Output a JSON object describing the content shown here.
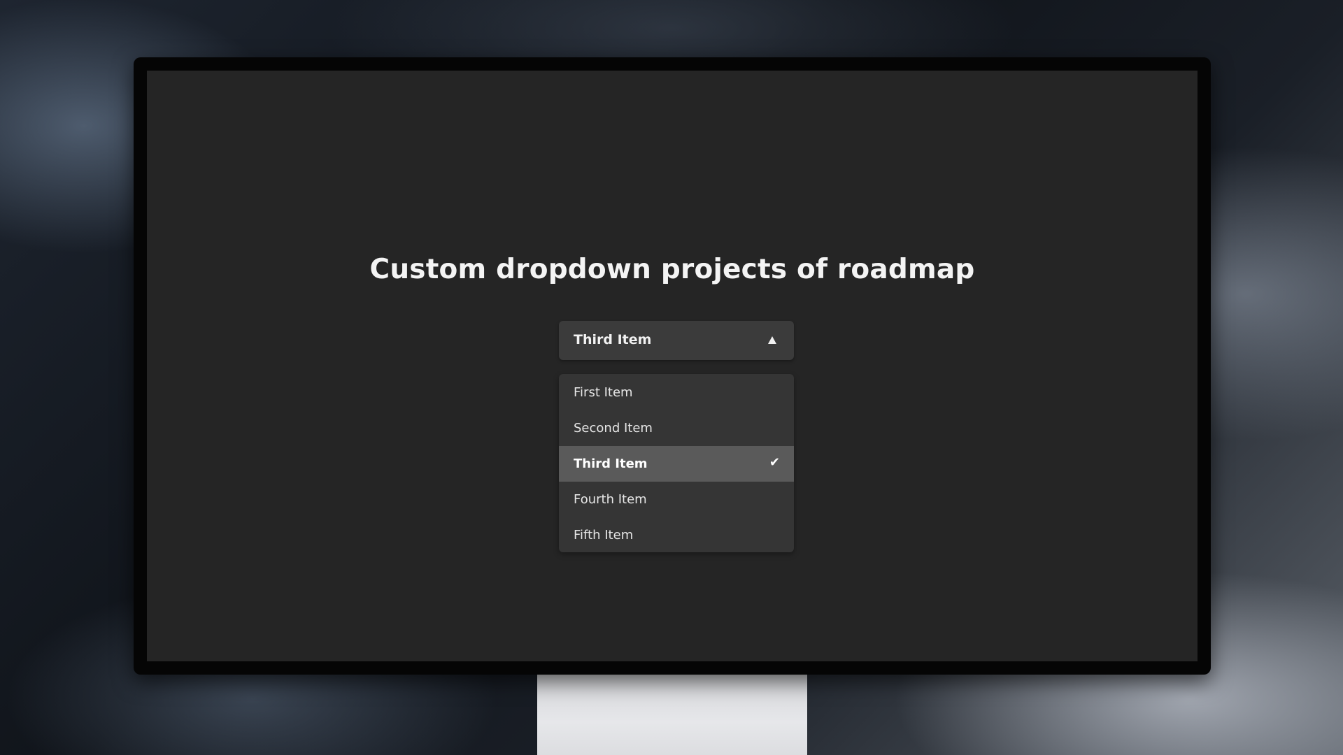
{
  "page": {
    "title": "Custom dropdown projects of roadmap"
  },
  "dropdown": {
    "selected_label": "Third Item",
    "toggle_icon": "caret-up-icon",
    "is_open": true,
    "options": [
      {
        "label": "First Item",
        "selected": false
      },
      {
        "label": "Second Item",
        "selected": false
      },
      {
        "label": "Third Item",
        "selected": true,
        "icon": "check-icon",
        "glyph": "✔"
      },
      {
        "label": "Fourth Item",
        "selected": false
      },
      {
        "label": "Fifth Item",
        "selected": false
      }
    ]
  },
  "colors": {
    "screen_background": "#252525",
    "select_background": "#3b3b3b",
    "list_background": "#353535",
    "selected_option_background": "#5a5a5a",
    "text": "#f2f2f2"
  }
}
